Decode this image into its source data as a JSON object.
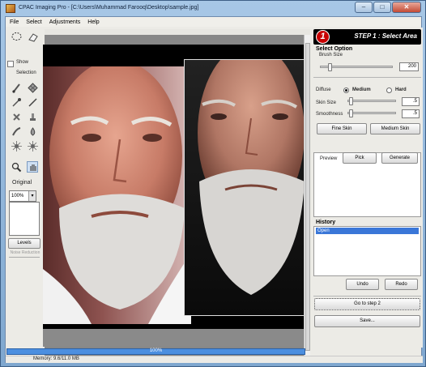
{
  "window": {
    "title": "CPAC Imaging Pro - [C:\\Users\\Muhammad Farooq\\Desktop\\sample.jpg]",
    "controls": {
      "minimize": "–",
      "maximize": "□",
      "close": "✕"
    }
  },
  "menu": [
    "File",
    "Select",
    "Adjustments",
    "Help"
  ],
  "tools": {
    "show_label": "Show",
    "selection_label": "Selection",
    "original_label": "Original",
    "zoom_value": "100%",
    "levels_label": "Levels",
    "noise_label": "Noise Reduction"
  },
  "right_panel": {
    "step_number": "1",
    "step_title": "STEP 1 : Select Area",
    "select_option": "Select Option",
    "brush_size_label": "Brush Size",
    "brush_size_value": "200",
    "brush_size_level": 0.1,
    "diffuse_label": "Diffuse",
    "radio_medium": "Medium",
    "radio_hard": "Hard",
    "diffuse_selected": "Medium",
    "skin_size_label": "Skin Size",
    "skin_size_value": ".5",
    "smoothness_label": "Smoothness",
    "smoothness_value": ".5",
    "fine_skin": "Fine Skin",
    "medium_skin": "Medium Skin",
    "preview_label": "Preview",
    "pick_label": "Pick",
    "generate_label": "Generate",
    "history_title": "History",
    "history_items": [
      "Open"
    ],
    "undo_label": "Undo",
    "redo_label": "Redo",
    "go_step2": "Go to step 2",
    "save_label": "Save..."
  },
  "status": {
    "progress": "100%",
    "progress_fraction": 1.0,
    "memory": "Memory: 9.6/11.0 MB"
  }
}
